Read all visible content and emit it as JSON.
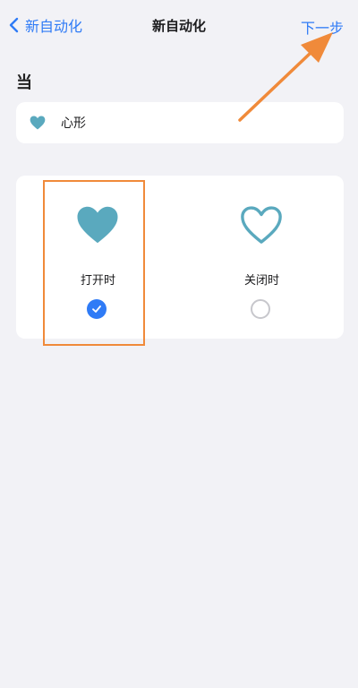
{
  "navbar": {
    "back_label": "新自动化",
    "title": "新自动化",
    "next_label": "下一步"
  },
  "section": {
    "label": "当"
  },
  "trigger": {
    "icon": "heart-icon",
    "text": "心形"
  },
  "options": [
    {
      "label": "打开时",
      "icon": "heart-filled-icon",
      "selected": true
    },
    {
      "label": "关闭时",
      "icon": "heart-outline-icon",
      "selected": false
    }
  ],
  "colors": {
    "accent": "#2f7bf6",
    "heart": "#5aa9be",
    "annotation": "#f08a3a",
    "background": "#f2f2f6"
  }
}
